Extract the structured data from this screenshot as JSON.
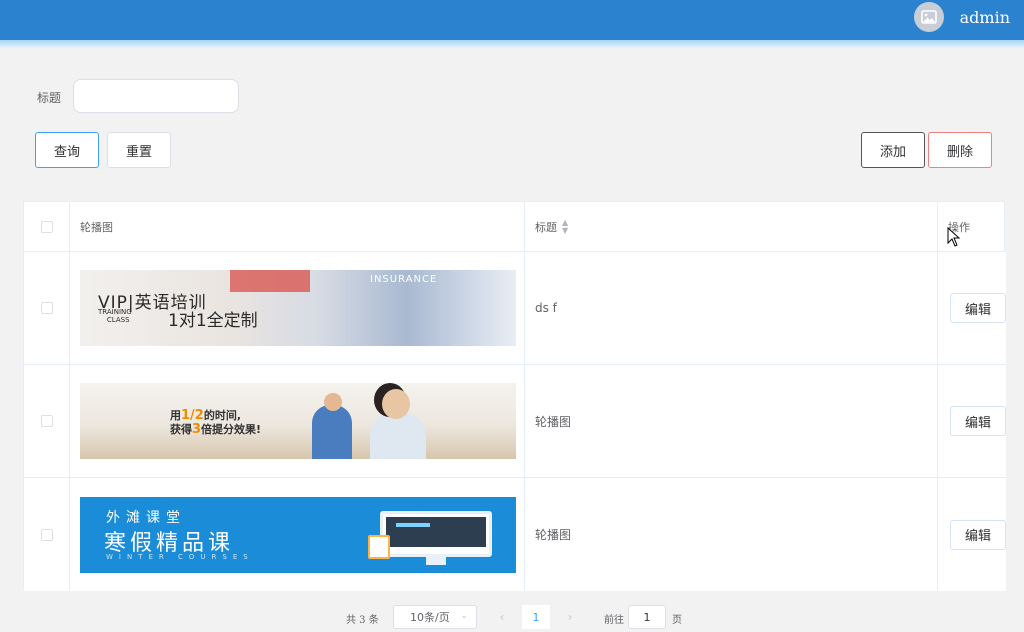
{
  "header": {
    "username": "admin",
    "avatar_icon": "image-icon",
    "bar_color": "#2b83d0"
  },
  "filter": {
    "title_label": "标题",
    "title_value": "",
    "query_label": "查询",
    "reset_label": "重置"
  },
  "toolbar": {
    "add_label": "添加",
    "delete_label": "删除"
  },
  "table": {
    "columns": [
      "轮播图",
      "标题",
      "操作"
    ],
    "edit_label": "编辑",
    "rows": [
      {
        "title": "ds f",
        "banner": {
          "line1": "VIP|英语培训",
          "line2a": "TRAINING",
          "line2b": "CLASS",
          "line3": "1对1全定制",
          "tag": "INSURANCE"
        }
      },
      {
        "title": "轮播图",
        "banner": {
          "line1_pre": "用",
          "line1_hl": "1/2",
          "line1_post": "的时间,",
          "line2_pre": "获得",
          "line2_hl": "3",
          "line2_post": "倍提分效果!"
        }
      },
      {
        "title": "轮播图",
        "banner": {
          "line1": "外滩课堂",
          "line2": "寒假精品课",
          "line3": "WINTER COURSES"
        }
      }
    ]
  },
  "pagination": {
    "total_text": "共 3 条",
    "page_size": "10条/页",
    "current_page": "1",
    "goto_label": "前往",
    "goto_value": "1",
    "page_unit": "页"
  }
}
